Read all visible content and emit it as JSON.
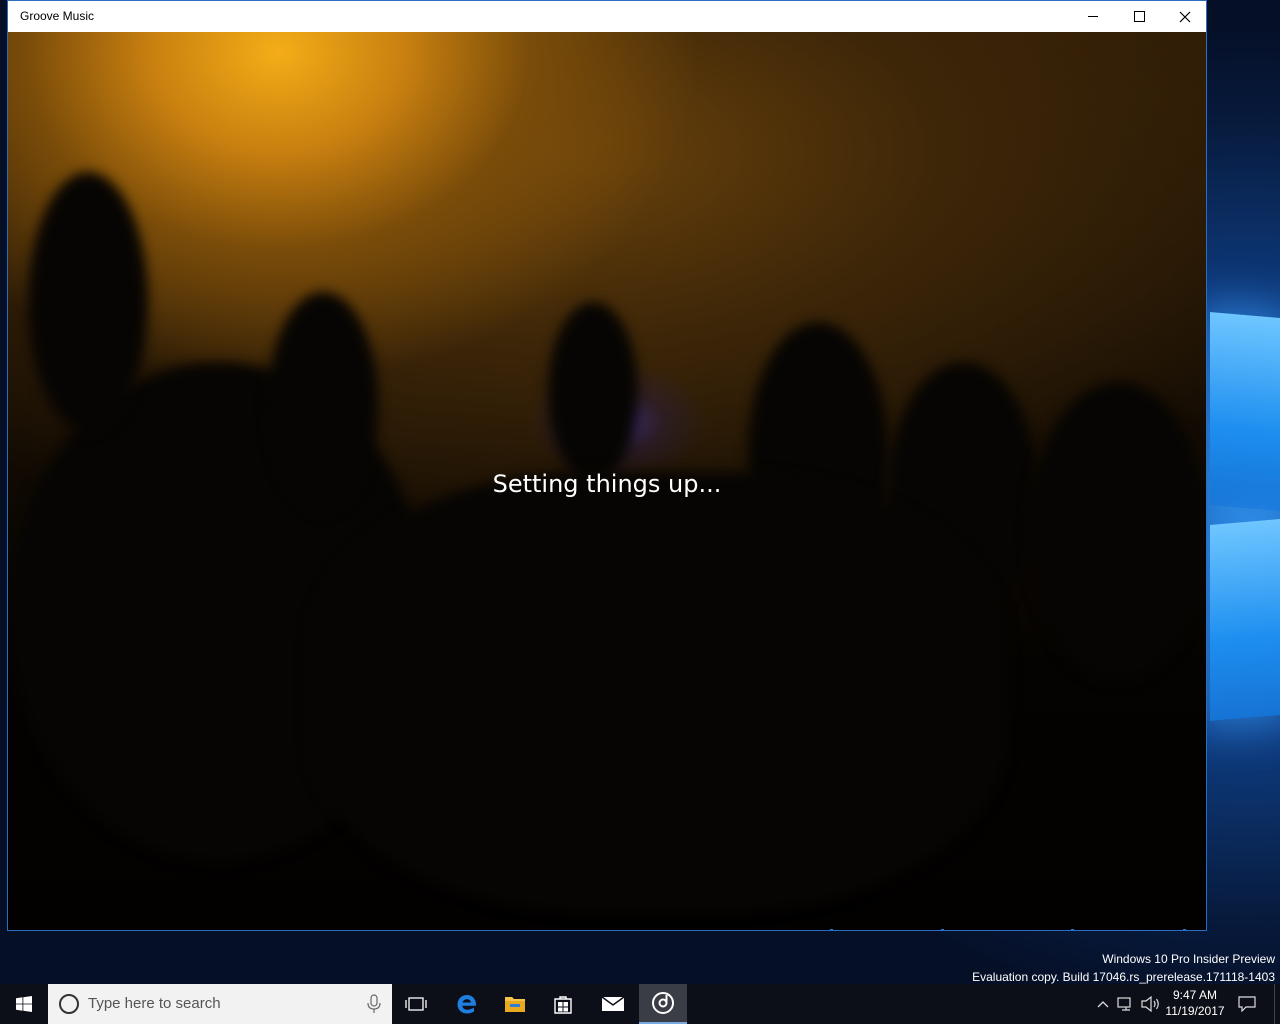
{
  "window": {
    "title": "Groove Music",
    "minimize_icon": "minimize-icon",
    "maximize_icon": "maximize-icon",
    "close_icon": "close-icon"
  },
  "app": {
    "loading_message": "Setting things up..."
  },
  "watermark": {
    "line1": "Windows 10 Pro Insider Preview",
    "line2": "Evaluation copy. Build 17046.rs_prerelease.171118-1403"
  },
  "taskbar": {
    "search_placeholder": "Type here to search",
    "icons": [
      "windows-start-icon",
      "cortana-icon",
      "microphone-icon",
      "task-view-icon",
      "edge-icon",
      "file-explorer-icon",
      "store-icon",
      "mail-icon",
      "groove-music-icon",
      "chevron-up-icon",
      "network-icon",
      "volume-icon",
      "action-center-icon"
    ],
    "clock_time": "9:47 AM",
    "clock_date": "11/19/2017"
  },
  "colors": {
    "accent": "#1a7be0",
    "taskbar": "#0c0f18",
    "title_bar": "#ffffff"
  }
}
